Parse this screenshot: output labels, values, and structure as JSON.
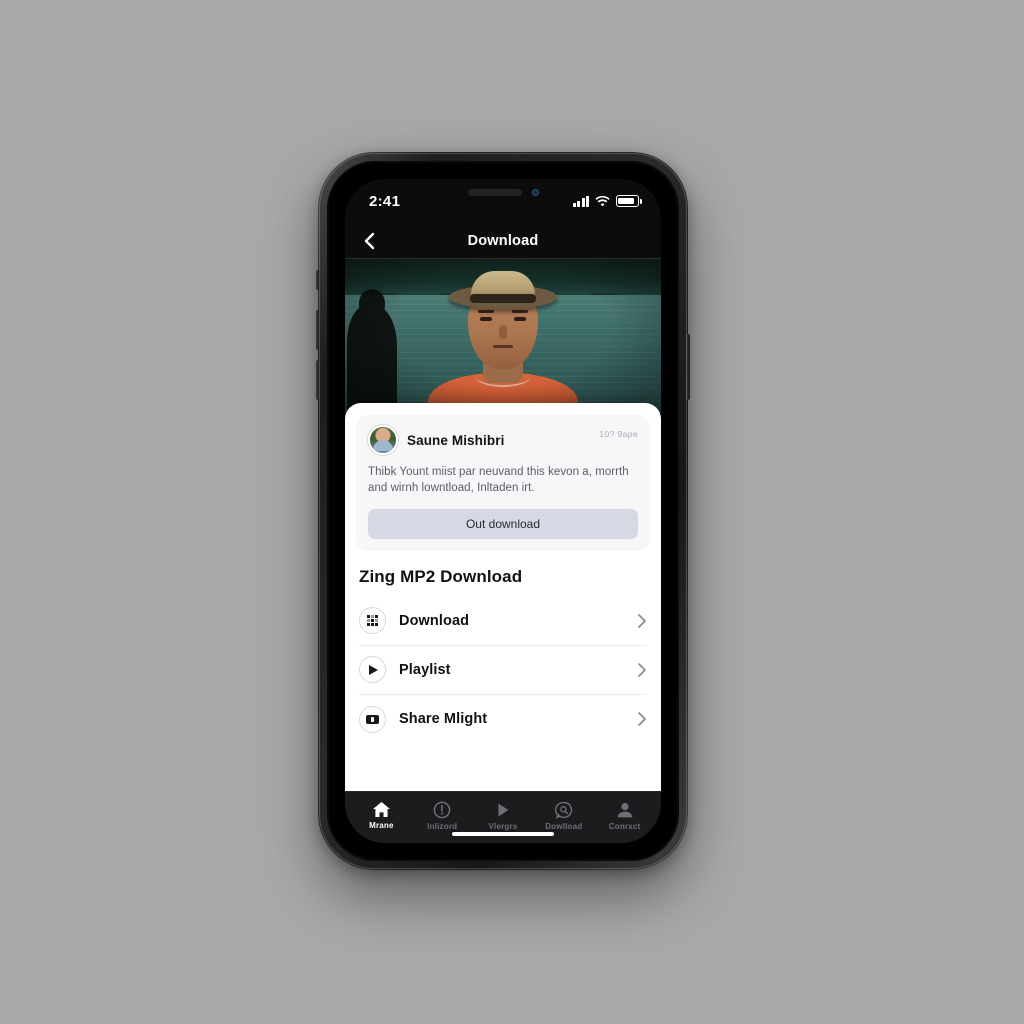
{
  "background_color": "#a8a8a8",
  "device": {
    "frame_color": "#1d1d1f",
    "buttons": [
      "mute-switch",
      "volume-up",
      "volume-down",
      "power"
    ]
  },
  "status_bar": {
    "time": "2:41",
    "signal_icon": "cellular-bars-icon",
    "wifi_icon": "wifi-icon",
    "battery_icon": "battery-icon",
    "notch": {
      "speaker": "speaker-slot",
      "camera": "front-camera-dot"
    }
  },
  "nav": {
    "back_icon": "chevron-left-icon",
    "title": "Download"
  },
  "hero": {
    "type": "video-still",
    "description": "man in straw fedora hat on a lake, teal water, dark treeline, silhouette figure at left"
  },
  "post_card": {
    "avatar": "user-avatar",
    "author": "Saune Mishibri",
    "meta": "10? 9ape",
    "body": "Thibk Yount miist par neuvand this kevon a, morrth and wirnh lowntload, Inltaden irt.",
    "action_label": "Out download",
    "action_color": "#d6d9e3"
  },
  "section": {
    "title": "Zing MP2 Download"
  },
  "list": {
    "chevron_icon": "chevron-right-icon",
    "items": [
      {
        "label": "Download",
        "icon": "grid-apps-icon"
      },
      {
        "label": "Playlist",
        "icon": "play-icon"
      },
      {
        "label": "Share Mlight",
        "icon": "card-screen-icon"
      }
    ]
  },
  "tab_bar": {
    "background": "#1c1c1e",
    "active_color": "#ffffff",
    "inactive_color": "#6f6f75",
    "items": [
      {
        "label": "Mrane",
        "icon": "home-icon",
        "active": true
      },
      {
        "label": "Inlizord",
        "icon": "alert-circle-icon",
        "active": false
      },
      {
        "label": "Vlergrs",
        "icon": "play-icon",
        "active": false
      },
      {
        "label": "Dowlload",
        "icon": "chat-search-icon",
        "active": false
      },
      {
        "label": "Conrxct",
        "icon": "person-icon",
        "active": false
      }
    ]
  },
  "home_indicator": "home-indicator-bar"
}
